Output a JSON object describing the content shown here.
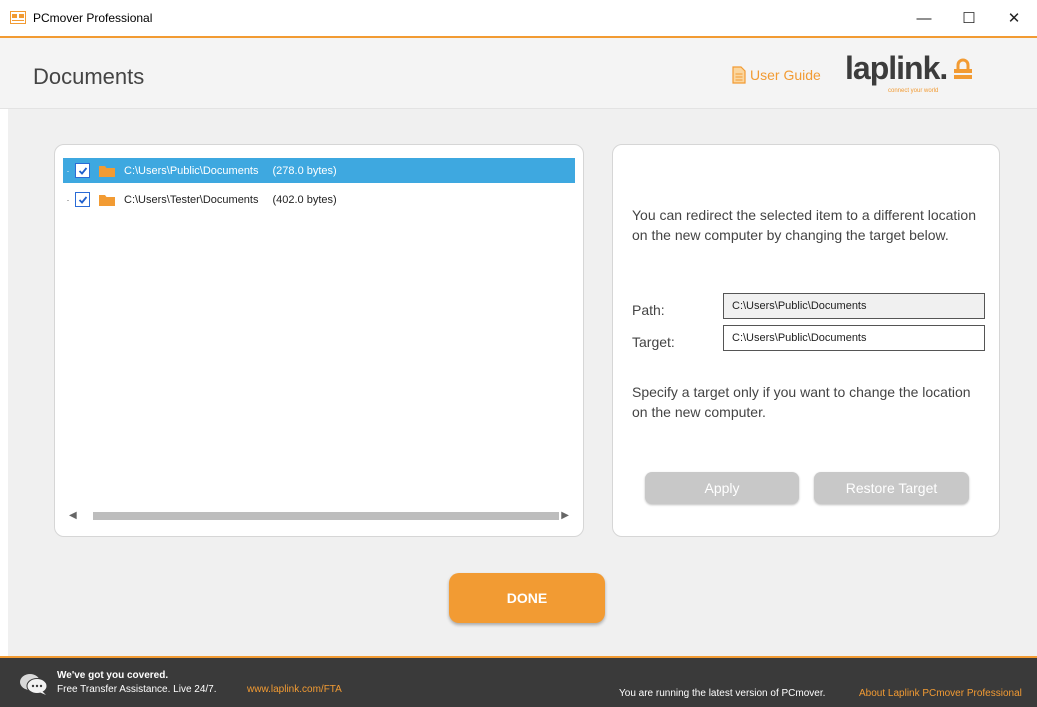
{
  "window": {
    "title": "PCmover Professional",
    "minimize": "—",
    "maximize": "☐",
    "close": "✕"
  },
  "header": {
    "page_title": "Documents",
    "user_guide_label": "User Guide",
    "logo_text": "laplink.",
    "logo_tagline": "connect your world"
  },
  "tree": {
    "items": [
      {
        "path": "C:\\Users\\Public\\Documents",
        "size": "(278.0 bytes)",
        "checked": true,
        "selected": true
      },
      {
        "path": "C:\\Users\\Tester\\Documents",
        "size": "(402.0 bytes)",
        "checked": true,
        "selected": false
      }
    ]
  },
  "details": {
    "description": "You can redirect the selected item to a different location on the new computer by changing the target below.",
    "path_label": "Path:",
    "path_value": "C:\\Users\\Public\\Documents",
    "target_label": "Target:",
    "target_value": "C:\\Users\\Public\\Documents",
    "hint": "Specify a target only if you want to change the location on the new computer.",
    "apply_label": "Apply",
    "restore_label": "Restore Target"
  },
  "done_label": "DONE",
  "footer": {
    "title": "We've got you covered.",
    "subtitle": "Free Transfer Assistance. Live 24/7.",
    "link": "www.laplink.com/FTA",
    "status": "You are running the latest version of PCmover.",
    "about": "About Laplink PCmover Professional"
  },
  "colors": {
    "accent": "#f29b33",
    "selection": "#3ea8e0",
    "footer_bg": "#3a3a3a"
  },
  "icons": [
    "app-icon",
    "minimize-icon",
    "maximize-icon",
    "close-icon",
    "document-icon",
    "lock-icon",
    "folder-icon",
    "checkmark-icon",
    "chat-icon"
  ]
}
